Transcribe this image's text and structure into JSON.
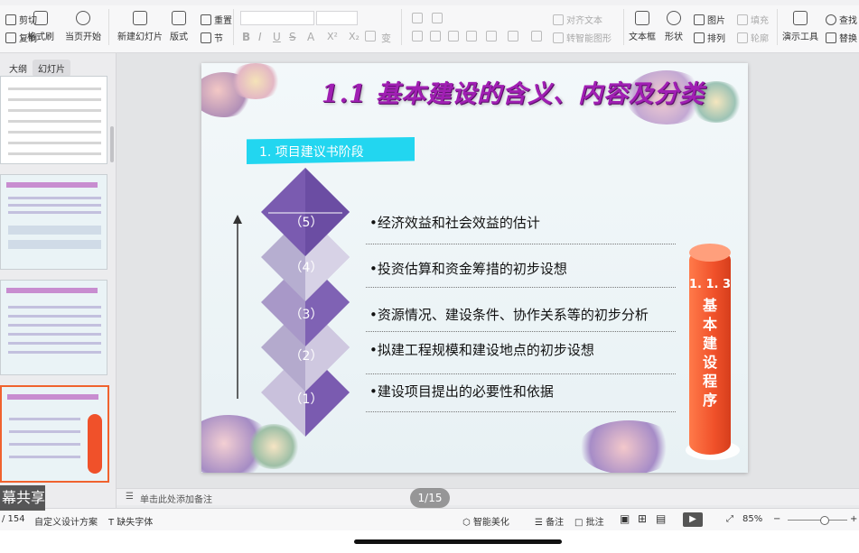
{
  "toolbar": {
    "cut": "剪切",
    "copy": "复制",
    "format_painter": "格式刷",
    "play_from_current": "当页开始",
    "new_slide": "新建幻灯片",
    "layout": "版式",
    "section": "节",
    "reset": "重置",
    "align_text": "对齐文本",
    "smart_graphic": "转智能图形",
    "textbox": "文本框",
    "shape": "形状",
    "picture": "图片",
    "arrange": "排列",
    "fill": "填充",
    "outline": "轮廓",
    "presentation_tools": "演示工具",
    "find": "查找",
    "replace": "替换"
  },
  "panel": {
    "tab_outline": "大纲",
    "tab_slides": "幻灯片"
  },
  "slide": {
    "title": "1.1 基本建设的含义、内容及分类",
    "stage_label": "1. 项目建议书阶段",
    "steps": [
      {
        "num": "（5）",
        "text": "•经济效益和社会效益的估计"
      },
      {
        "num": "（4）",
        "text": "•投资估算和资金筹措的初步设想"
      },
      {
        "num": "（3）",
        "text": "•资源情况、建设条件、协作关系等的初步分析"
      },
      {
        "num": "（2）",
        "text": "•拟建工程规模和建设地点的初步设想"
      },
      {
        "num": "（1）",
        "text": "•建设项目提出的必要性和依据"
      }
    ],
    "pill_code": "1. 1. 3",
    "pill_text": [
      "基",
      "本",
      "建",
      "设",
      "程",
      "序"
    ]
  },
  "notes": {
    "placeholder": "单击此处添加备注"
  },
  "page_indicator": "1/15",
  "status": {
    "slide_count": "/ 154",
    "design": "自定义设计方案",
    "missing_font": "缺失字体",
    "smart_beautify": "智能美化",
    "notes": "备注",
    "comment": "批注",
    "zoom": "85%"
  },
  "share_overlay": "幕共享",
  "colors": {
    "title": "#a01fb3",
    "stage": "#22d6f0",
    "pill": "#f0512a",
    "diamond": "#7a5bb0"
  }
}
